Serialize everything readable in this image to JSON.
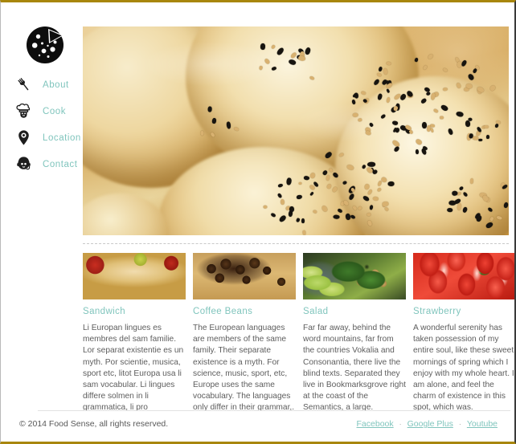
{
  "site": {
    "name": "Food Sense",
    "logo_icon": "pizza-icon"
  },
  "sidebar": {
    "items": [
      {
        "label": "About",
        "icon": "fork-icon"
      },
      {
        "label": "Cook",
        "icon": "chef-hat-icon"
      },
      {
        "label": "Location",
        "icon": "map-pin-icon"
      },
      {
        "label": "Contact",
        "icon": "headset-person-icon"
      }
    ]
  },
  "hero": {
    "alt": "close-up of glazed sesame seed pastry buns"
  },
  "cards": [
    {
      "title": "Sandwich",
      "image": "sandwich-photo",
      "body": "Li Europan lingues es membres del sam familie. Lor separat existentie es un myth. Por scientie, musica, sport etc, litot Europa usa li sam vocabular. Li lingues differe solmen in li grammatica, li pro"
    },
    {
      "title": "Coffee Beans",
      "image": "coffee-beans-photo",
      "body": "The European languages are members of the same family. Their separate existence is a myth. For science, music, sport, etc, Europe uses the same vocabulary. The languages only differ in their grammar,."
    },
    {
      "title": "Salad",
      "image": "salad-photo",
      "body": "Far far away, behind the word mountains, far from the countries Vokalia and Consonantia, there live the blind texts. Separated they live in Bookmarksgrove right at the coast of the Semantics, a large."
    },
    {
      "title": "Strawberry",
      "image": "strawberry-photo",
      "body": "A wonderful serenity has taken possession of my entire soul, like these sweet mornings of spring which I enjoy with my whole heart. I am alone, and feel the charm of existence in this spot, which was."
    }
  ],
  "footer": {
    "copyright": "© 2014 Food Sense, all rights reserved.",
    "separator": "·",
    "social": [
      {
        "label": "Facebook"
      },
      {
        "label": "Google Plus"
      },
      {
        "label": "Youtube"
      }
    ]
  },
  "colors": {
    "accent_teal": "#80c5bd",
    "border_olive": "#a8860c",
    "body_text": "#5d5d5d",
    "divider_gray": "#c8c8c8"
  }
}
